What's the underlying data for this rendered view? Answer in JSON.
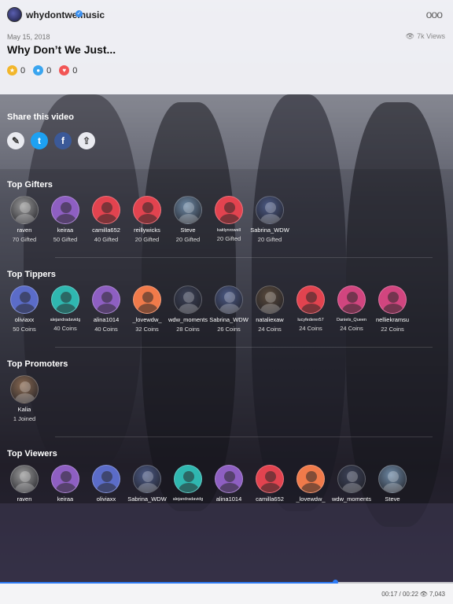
{
  "header": {
    "channel": "whydontwemusic",
    "verified_icon": "✓",
    "more_icon": "ooo",
    "date": "May 15, 2018",
    "views": "7k",
    "views_label": "Views",
    "eye_icon": "👁",
    "title": "Why Don’t We Just...",
    "reactions": [
      {
        "icon": "coin-icon",
        "glyph": "★",
        "color": "#f2b62a",
        "count": "0"
      },
      {
        "icon": "drop-icon",
        "glyph": "●",
        "color": "#3aa5ef",
        "count": "0"
      },
      {
        "icon": "heart-icon",
        "glyph": "♥",
        "color": "#f25555",
        "count": "0"
      }
    ]
  },
  "share": {
    "title": "Share this video",
    "buttons": [
      {
        "name": "tag-share-button",
        "glyph": "✎",
        "color": "#e9eaf0",
        "fg": "#333"
      },
      {
        "name": "twitter-share-button",
        "glyph": "t",
        "color": "#1da1f2",
        "fg": "#fff"
      },
      {
        "name": "facebook-share-button",
        "glyph": "f",
        "color": "#3b5998",
        "fg": "#fff"
      },
      {
        "name": "export-share-button",
        "glyph": "⇪",
        "color": "#e9eaf0",
        "fg": "#444"
      }
    ]
  },
  "gifters": {
    "title": "Top Gifters",
    "items": [
      {
        "name": "raven",
        "count": "70 Gifted",
        "color": "#9a9a9a",
        "photo": true
      },
      {
        "name": "keiraa",
        "count": "50 Gifted",
        "color": "#8e5fc2",
        "photo": false
      },
      {
        "name": "camilla652",
        "count": "40 Gifted",
        "color": "#e2434f",
        "photo": false
      },
      {
        "name": "reillywicks",
        "count": "20 Gifted",
        "color": "#e2434f",
        "photo": false
      },
      {
        "name": "Steve",
        "count": "20 Gifted",
        "color": "#6e8aa6",
        "photo": true
      },
      {
        "name": "kaitlynrowell",
        "count": "20 Gifted",
        "color": "#e2434f",
        "photo": false
      },
      {
        "name": "Sabrina_WDW",
        "count": "20 Gifted",
        "color": "#4c5a86",
        "photo": true
      }
    ]
  },
  "tippers": {
    "title": "Top Tippers",
    "items": [
      {
        "name": "oliviaxx",
        "count": "50 Coins",
        "color": "#5b6cc8",
        "photo": false
      },
      {
        "name": "alejandradavidg",
        "count": "40 Coins",
        "color": "#2fb7b0",
        "photo": false
      },
      {
        "name": "alina1014",
        "count": "40 Coins",
        "color": "#8e5fc2",
        "photo": false
      },
      {
        "name": "_lovewdw_",
        "count": "32 Coins",
        "color": "#f07a4a",
        "photo": false
      },
      {
        "name": "wdw_moments",
        "count": "28 Coins",
        "color": "#3c4258",
        "photo": true
      },
      {
        "name": "Sabrina_WDW",
        "count": "26 Coins",
        "color": "#4c5a86",
        "photo": true
      },
      {
        "name": "nataliexaw",
        "count": "24 Coins",
        "color": "#5a4a3c",
        "photo": true
      },
      {
        "name": "lucyfederer57",
        "count": "24 Coins",
        "color": "#e2434f",
        "photo": false
      },
      {
        "name": "Daniels_Queen",
        "count": "24 Coins",
        "color": "#d1457f",
        "photo": false
      },
      {
        "name": "nelliekramsu",
        "count": "22 Coins",
        "color": "#d1457f",
        "photo": false
      }
    ]
  },
  "promoters": {
    "title": "Top Promoters",
    "items": [
      {
        "name": "Kalia",
        "count": "1 Joined",
        "color": "#8a6a52",
        "photo": true
      }
    ]
  },
  "viewers": {
    "title": "Top Viewers",
    "items": [
      {
        "name": "raven",
        "color": "#9a9a9a",
        "photo": true
      },
      {
        "name": "keiraa",
        "color": "#8e5fc2",
        "photo": false
      },
      {
        "name": "oliviaxx",
        "color": "#5b6cc8",
        "photo": false
      },
      {
        "name": "Sabrina_WDW",
        "color": "#4c5a86",
        "photo": true
      },
      {
        "name": "alejandradavidg",
        "color": "#2fb7b0",
        "photo": false
      },
      {
        "name": "alina1014",
        "color": "#8e5fc2",
        "photo": false
      },
      {
        "name": "camilla652",
        "color": "#e2434f",
        "photo": false
      },
      {
        "name": "_lovewdw_",
        "color": "#f07a4a",
        "photo": false
      },
      {
        "name": "wdw_moments",
        "color": "#3c4258",
        "photo": true
      },
      {
        "name": "Steve",
        "color": "#6e8aa6",
        "photo": true
      }
    ]
  },
  "player": {
    "progress": 0.74,
    "time": "00:17 / 00:22",
    "plays": "7,043",
    "plays_icon": "👁"
  }
}
